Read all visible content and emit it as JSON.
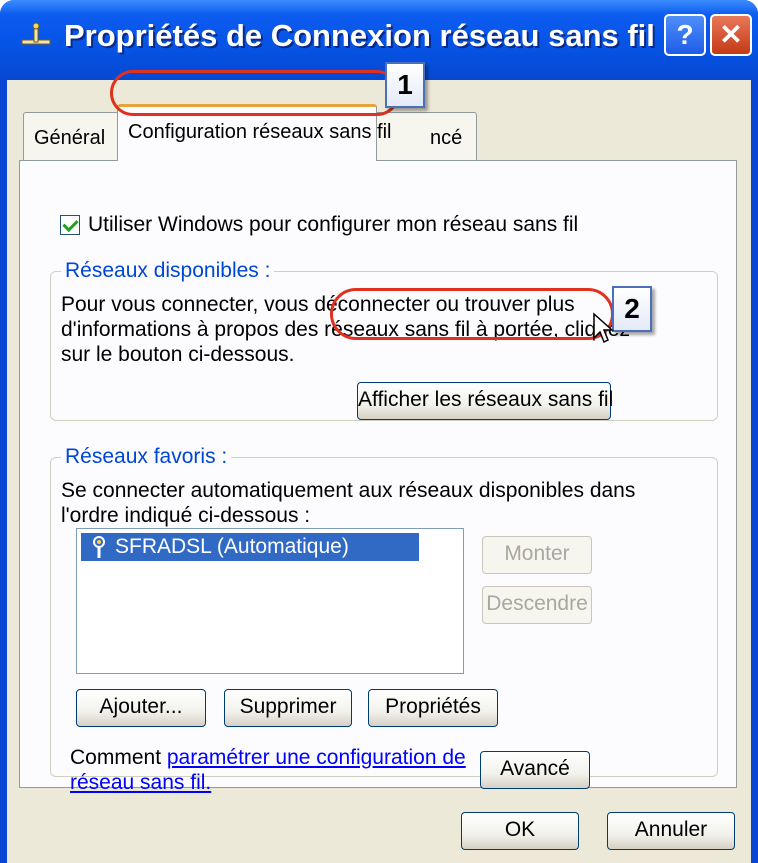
{
  "window": {
    "title": "Propriétés de Connexion réseau sans fil",
    "help_label": "?",
    "close_label": "✕",
    "icon": "network-connection-icon"
  },
  "tabs": [
    {
      "label": "Général",
      "active": false
    },
    {
      "label": "Configuration réseaux sans fil",
      "active": true
    },
    {
      "label": "Avancé",
      "active": false,
      "visible_text": "ncé"
    }
  ],
  "panel": {
    "use_windows_checkbox": {
      "label": "Utiliser Windows pour configurer mon réseau sans fil",
      "checked": true
    },
    "available": {
      "legend": "Réseaux disponibles :",
      "text_lines": [
        "Pour vous connecter, vous déconnecter ou trouver plus",
        "d'informations à propos des réseaux sans fil à portée, cliquez",
        "sur le bouton ci-dessous."
      ],
      "view_button": "Afficher les réseaux sans fil"
    },
    "preferred": {
      "legend": "Réseaux favoris :",
      "text_lines": [
        "Se connecter automatiquement aux réseaux disponibles dans",
        "l'ordre indiqué ci-dessous :"
      ],
      "networks": [
        {
          "name": "SFRADSL (Automatique)",
          "selected": true,
          "icon": "wireless-antenna-icon"
        }
      ],
      "move_up_button": "Monter",
      "move_down_button": "Descendre",
      "add_button": "Ajouter...",
      "remove_button": "Supprimer",
      "properties_button": "Propriétés",
      "help_prefix": "Comment ",
      "help_link_line1": "paramétrer une configuration de",
      "help_link_line2": "réseau sans fil.",
      "advanced_button": "Avancé"
    }
  },
  "footer": {
    "ok_button": "OK",
    "cancel_button": "Annuler"
  },
  "annotations": {
    "step1": "1",
    "step2": "2",
    "ring_color": "#e0301e"
  },
  "colors": {
    "titlebar": "#0654e6",
    "legend": "#0046d5",
    "selection": "#316ac5",
    "face": "#ece9d8"
  }
}
